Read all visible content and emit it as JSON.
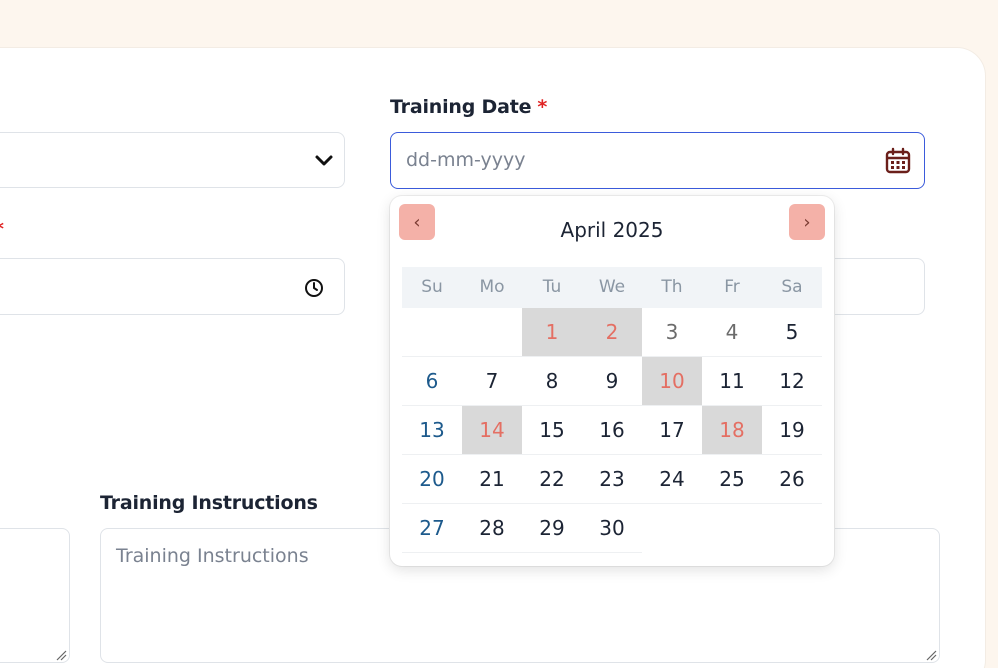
{
  "form": {
    "training_date": {
      "label": "Training Date",
      "required_mark": "*",
      "placeholder": "dd-mm-yyyy",
      "icon": "calendar-icon"
    },
    "left_time_required_mark": "*",
    "training_instructions": {
      "label": "Training Instructions",
      "placeholder": "Training Instructions"
    }
  },
  "datepicker": {
    "month_title": "April 2025",
    "prev_symbol": "‹",
    "next_symbol": "›",
    "weekdays": [
      "Su",
      "Mo",
      "Tu",
      "We",
      "Th",
      "Fr",
      "Sa"
    ],
    "leading_empty": 2,
    "days": [
      {
        "d": "1",
        "state": "holiday"
      },
      {
        "d": "2",
        "state": "holiday"
      },
      {
        "d": "3",
        "state": "past"
      },
      {
        "d": "4",
        "state": "past"
      },
      {
        "d": "5",
        "state": "normal"
      },
      {
        "d": "6",
        "state": "sun"
      },
      {
        "d": "7",
        "state": "normal"
      },
      {
        "d": "8",
        "state": "normal"
      },
      {
        "d": "9",
        "state": "normal"
      },
      {
        "d": "10",
        "state": "holiday"
      },
      {
        "d": "11",
        "state": "normal"
      },
      {
        "d": "12",
        "state": "normal"
      },
      {
        "d": "13",
        "state": "sun"
      },
      {
        "d": "14",
        "state": "holiday"
      },
      {
        "d": "15",
        "state": "normal"
      },
      {
        "d": "16",
        "state": "normal"
      },
      {
        "d": "17",
        "state": "normal"
      },
      {
        "d": "18",
        "state": "holiday"
      },
      {
        "d": "19",
        "state": "normal"
      },
      {
        "d": "20",
        "state": "sun"
      },
      {
        "d": "21",
        "state": "normal"
      },
      {
        "d": "22",
        "state": "normal"
      },
      {
        "d": "23",
        "state": "normal"
      },
      {
        "d": "24",
        "state": "normal"
      },
      {
        "d": "25",
        "state": "normal"
      },
      {
        "d": "26",
        "state": "normal"
      },
      {
        "d": "27",
        "state": "sun"
      },
      {
        "d": "28",
        "state": "normal"
      },
      {
        "d": "29",
        "state": "normal"
      },
      {
        "d": "30",
        "state": "normal"
      }
    ]
  },
  "colors": {
    "page_bg": "#fdf6ee",
    "focus_border": "#3b5bdb",
    "required": "#e02424",
    "nav_button": "#f4b1a8",
    "holiday_bg": "#d9d9d9",
    "holiday_text": "#e46f63",
    "sunday_text": "#1d5a8c"
  }
}
